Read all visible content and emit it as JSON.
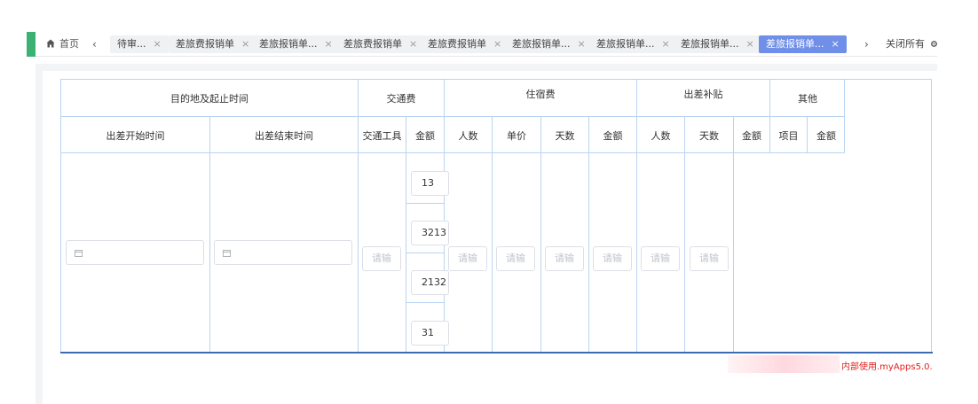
{
  "tabbar": {
    "home_label": "首页",
    "prev_arrow": "‹",
    "next_arrow": "›",
    "close_all_label": "关闭所有",
    "close_glyph": "×",
    "tabs": [
      {
        "label": "待审..."
      },
      {
        "label": "差旅费报销单"
      },
      {
        "label": "差旅报销单..."
      },
      {
        "label": "差旅费报销单"
      },
      {
        "label": "差旅费报销单"
      },
      {
        "label": "差旅报销单..."
      },
      {
        "label": "差旅报销单..."
      },
      {
        "label": "差旅报销单..."
      },
      {
        "label": "差旅报销单...",
        "active": true
      }
    ]
  },
  "table": {
    "group_headers": {
      "destination_time": "目的地及起止时间",
      "transport": "交通费",
      "lodging": "住宿费",
      "allowance": "出差补贴",
      "other": "其他"
    },
    "sub_headers": {
      "start_time": "出差开始时间",
      "end_time": "出差结束时间",
      "vehicle": "交通工具",
      "transport_amount": "金额",
      "lodging_people": "人数",
      "lodging_price": "单价",
      "lodging_days": "天数",
      "lodging_amount": "金额",
      "allowance_people": "人数",
      "allowance_days": "天数",
      "allowance_amount": "金额",
      "other_item": "项目",
      "other_amount": "金额"
    },
    "row": {
      "placeholder": "请输",
      "transport_amounts": [
        "13",
        "3213",
        "2132",
        "31"
      ]
    }
  },
  "watermark": "内部使用.myApps5.0.",
  "colors": {
    "accent_green": "#3bb273",
    "active_tab": "#6f8fe8",
    "table_border": "#b9d4f1",
    "table_bottom": "#3d6bb3",
    "watermark_red": "#e02020"
  }
}
